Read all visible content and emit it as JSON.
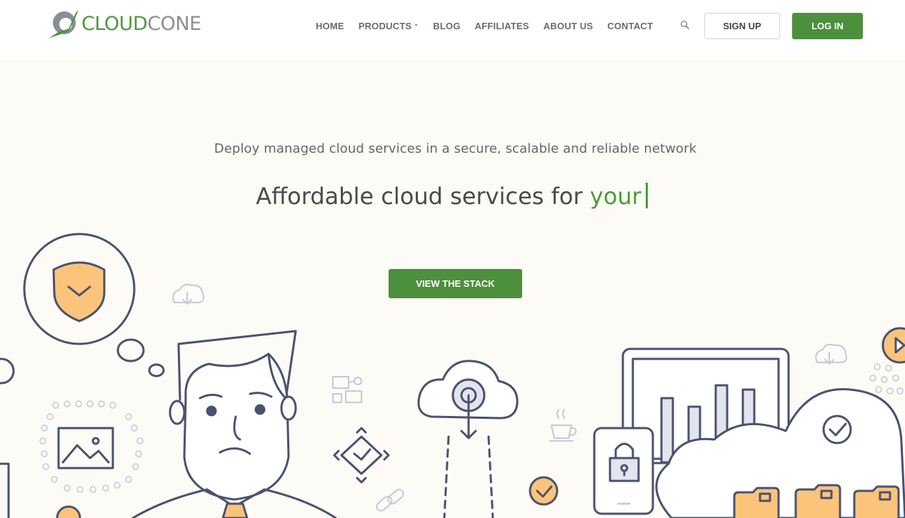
{
  "brand": {
    "name_part1": "CLOUD",
    "name_part2": "CONE"
  },
  "nav": {
    "items": [
      {
        "label": "HOME"
      },
      {
        "label": "PRODUCTS",
        "has_dropdown": true
      },
      {
        "label": "BLOG"
      },
      {
        "label": "AFFILIATES"
      },
      {
        "label": "ABOUT US"
      },
      {
        "label": "CONTACT"
      }
    ],
    "caret_glyph": "⌄",
    "search_icon": "search-icon"
  },
  "auth": {
    "signup_label": "SIGN UP",
    "login_label": "LOG IN"
  },
  "hero": {
    "subtitle": "Deploy managed cloud services in a secure, scalable and reliable network",
    "title_static": "Affordable cloud services for",
    "title_typed": "your",
    "cta_label": "VIEW THE STACK"
  },
  "colors": {
    "accent_green": "#4c8f3d",
    "brand_gray": "#8a8f96",
    "background": "#fdfbf5",
    "illustration_stroke": "#4a5270",
    "illustration_fill_orange": "#fcc47a",
    "illustration_fill_light": "#e4e4ee"
  }
}
